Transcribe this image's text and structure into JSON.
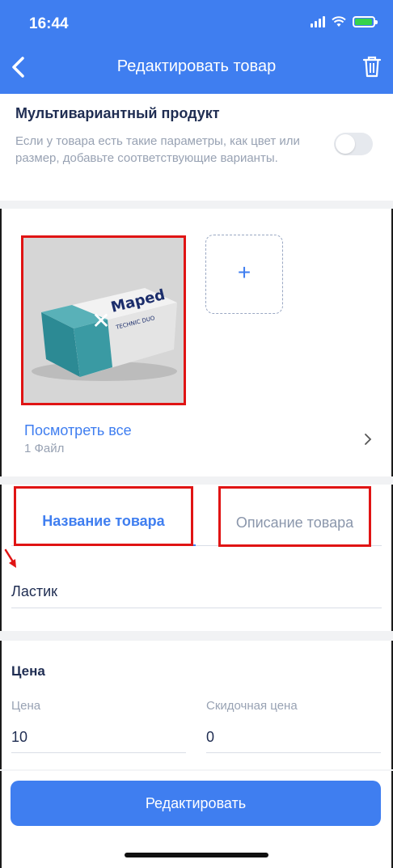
{
  "status": {
    "time": "16:44"
  },
  "header": {
    "title": "Редактировать товар"
  },
  "multivariant": {
    "title": "Мультивариантный продукт",
    "description": "Если у товара есть такие параметры, как цвет или размер, добавьте соответствующие варианты.",
    "enabled": false
  },
  "images": {
    "product_brand": "Maped",
    "product_sub": "TECHNIC DUO",
    "remove_symbol": "✕",
    "add_symbol": "+",
    "view_all_label": "Посмотреть все",
    "file_count": "1 Файл"
  },
  "tabs": [
    {
      "label": "Название товара",
      "active": true
    },
    {
      "label": "Описание товара",
      "active": false
    }
  ],
  "name_field": {
    "value": "Ластик"
  },
  "price": {
    "section_title": "Цена",
    "price_label": "Цена",
    "price_value": "10",
    "discount_label": "Скидочная цена",
    "discount_value": "0"
  },
  "submit_label": "Редактировать",
  "colors": {
    "primary": "#3f7ef0",
    "highlight": "#e01414",
    "text_dark": "#1f2d52",
    "text_muted": "#98a2b3"
  }
}
